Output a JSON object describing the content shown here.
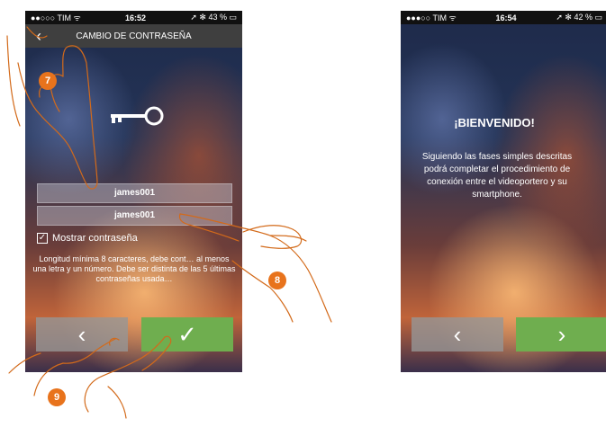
{
  "left_screen": {
    "status": {
      "carrier": "●●○○○ TIM ᯤ",
      "time": "16:52",
      "battery": "➚ ✻ 43 % ▭"
    },
    "title": "CAMBIO DE CONTRASEÑA",
    "username_value": "james001",
    "password_value": "james001",
    "show_password_label": "Mostrar contraseña",
    "show_password_checked": true,
    "hint": "Longitud mínima 8 caracteres, debe cont… al menos una letra y un número. Debe ser distinta de las 5 últimas contraseñas usada…",
    "buttons": {
      "prev_glyph": "‹",
      "ok_glyph": "✓"
    }
  },
  "right_screen": {
    "status": {
      "carrier": "●●●○○ TIM ᯤ",
      "time": "16:54",
      "battery": "➚ ✻ 42 % ▭"
    },
    "title": "¡BIENVENIDO!",
    "text": "Siguiendo las fases simples descritas podrá completar el procedimiento de conexión entre el videoportero y su smartphone.",
    "buttons": {
      "prev_glyph": "‹",
      "next_glyph": "›"
    }
  },
  "steps": {
    "seven": "7",
    "eight": "8",
    "nine": "9"
  },
  "colors": {
    "step_badge": "#e8731c",
    "confirm_button": "#6fae4f",
    "title_bar": "#3f3f3f"
  }
}
